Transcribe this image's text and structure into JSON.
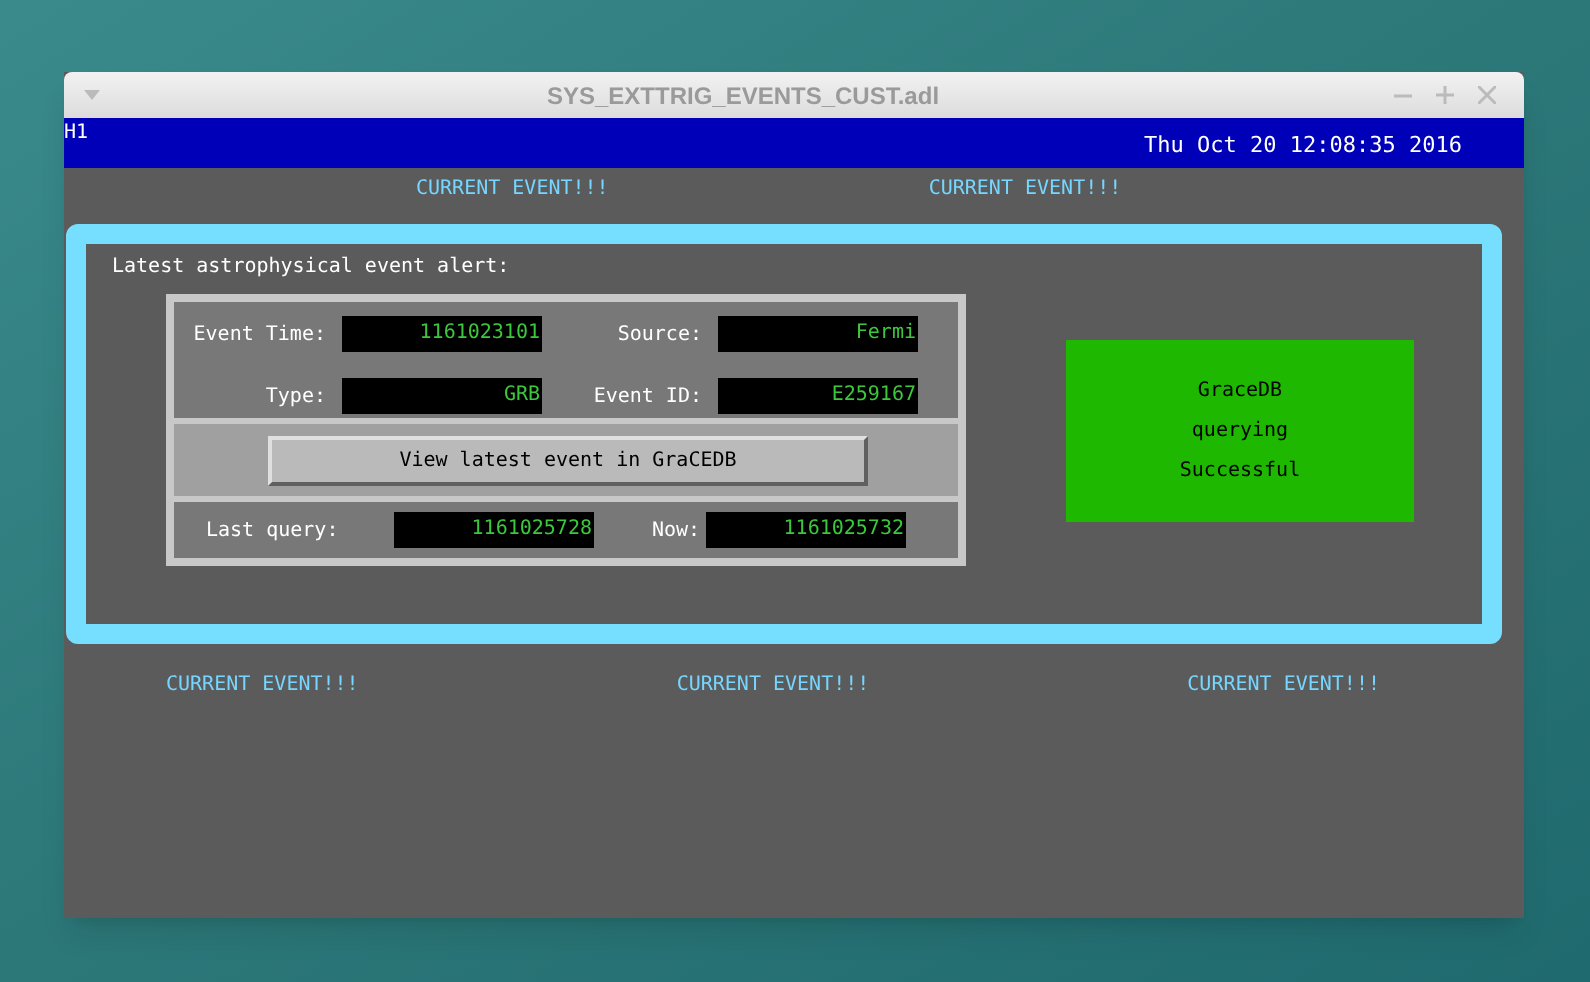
{
  "window": {
    "title": "SYS_EXTTRIG_EVENTS_CUST.adl"
  },
  "header": {
    "site": "H1",
    "datetime": "Thu Oct 20 12:08:35 2016"
  },
  "top_banners": [
    "CURRENT EVENT!!!",
    "CURRENT EVENT!!!"
  ],
  "alert": {
    "heading": "Latest astrophysical event alert:",
    "fields": [
      {
        "label": "Event Time:",
        "value": "1161023101"
      },
      {
        "label": "Source:",
        "value": "Fermi"
      },
      {
        "label": "Type:",
        "value": "GRB"
      },
      {
        "label": "Event ID:",
        "value": "E259167"
      }
    ],
    "button": "View latest event in GraCEDB",
    "query": [
      {
        "label": "Last query:",
        "value": "1161025728"
      },
      {
        "label": "Now:",
        "value": "1161025732"
      }
    ],
    "status": {
      "lines": [
        "GraceDB",
        "querying",
        "Successful"
      ],
      "color": "#1eb800"
    }
  },
  "bottom_banners": [
    "CURRENT EVENT!!!",
    "CURRENT EVENT!!!",
    "CURRENT EVENT!!!"
  ]
}
